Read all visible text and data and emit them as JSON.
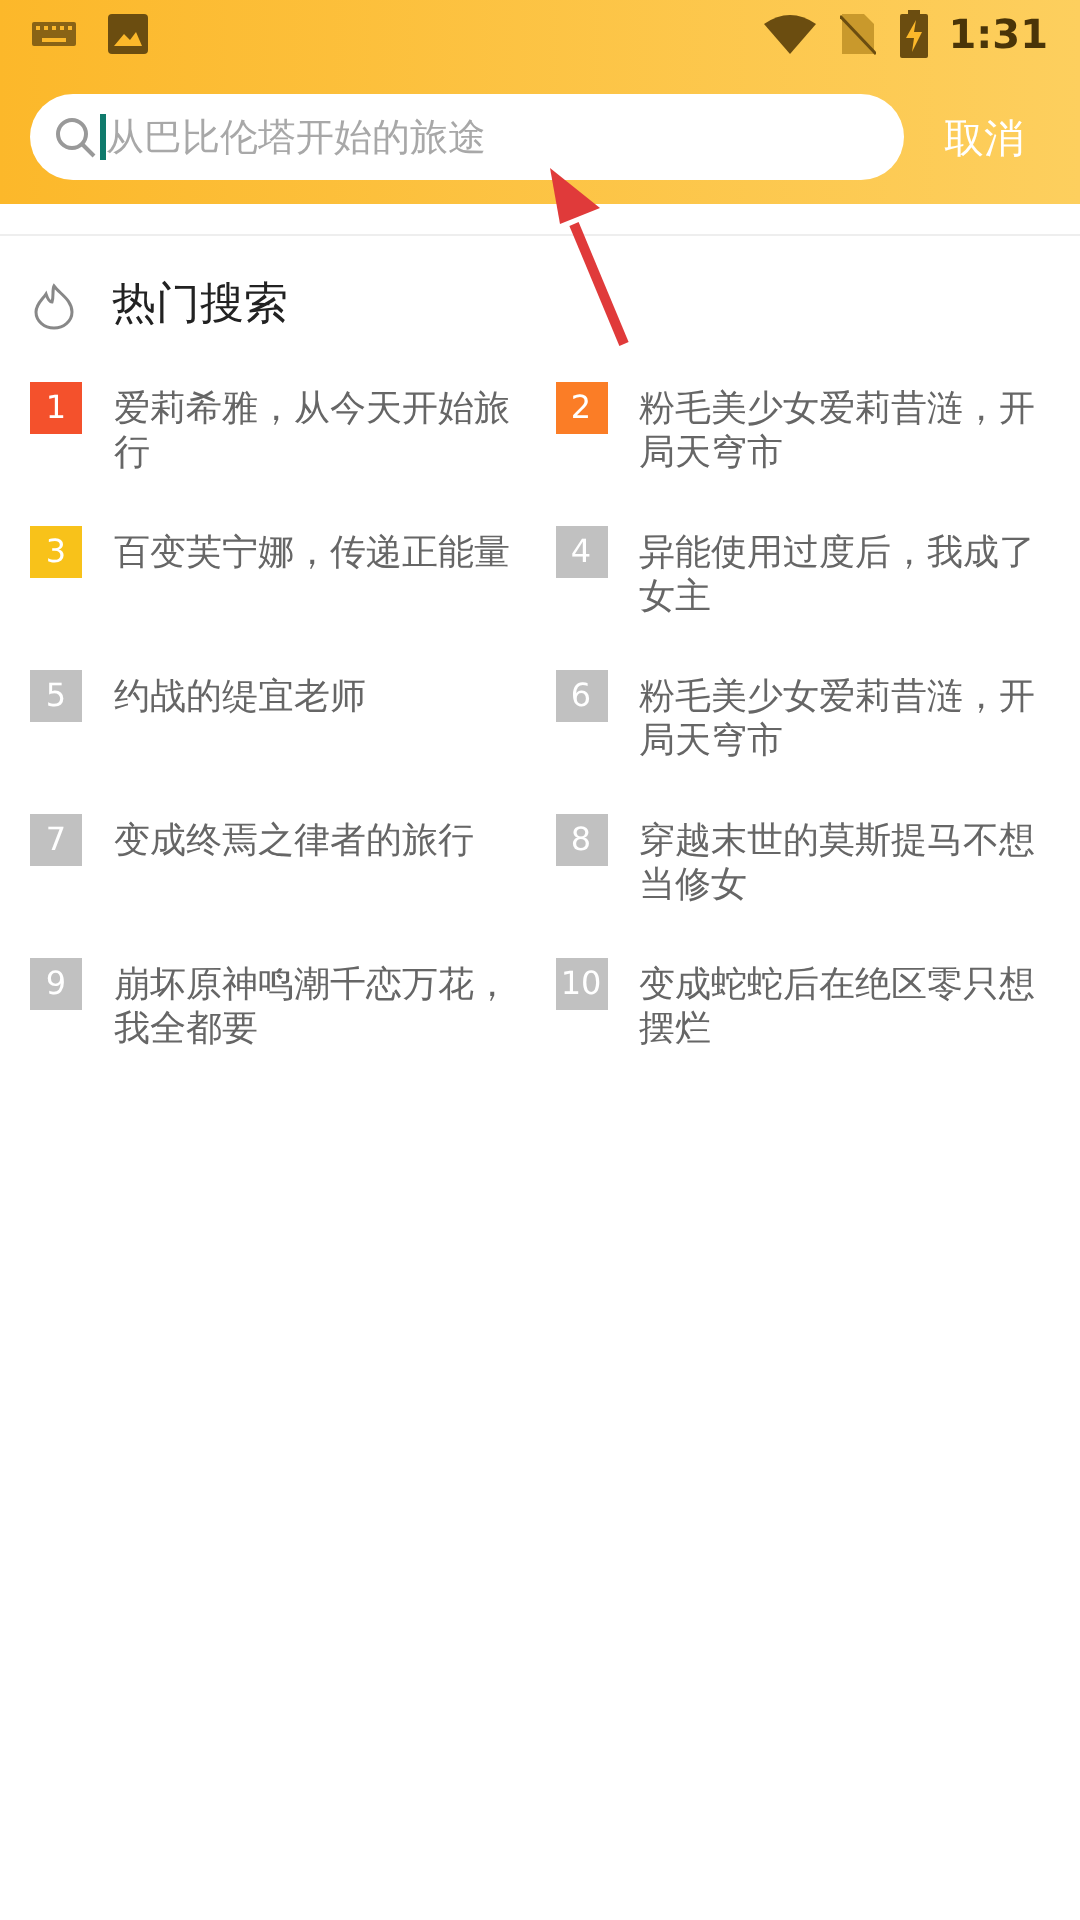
{
  "status_bar": {
    "time": "1:31"
  },
  "search": {
    "placeholder": "从巴比伦塔开始的旅途"
  },
  "cancel": "取消",
  "hot_search": {
    "title": "热门搜索",
    "items": [
      {
        "rank": "1",
        "title": "爱莉希雅，从今天开始旅行",
        "color": "#f4512c"
      },
      {
        "rank": "2",
        "title": "粉毛美少女爱莉昔涟，开局天穹市",
        "color": "#fb7d26"
      },
      {
        "rank": "3",
        "title": "百变芙宁娜，传递正能量",
        "color": "#f8c21a"
      },
      {
        "rank": "4",
        "title": "异能使用过度后，我成了女主",
        "color": "#c1c1c1"
      },
      {
        "rank": "5",
        "title": "约战的缇宜老师",
        "color": "#c1c1c1"
      },
      {
        "rank": "6",
        "title": "粉毛美少女爱莉昔涟，开局天穹市",
        "color": "#c1c1c1"
      },
      {
        "rank": "7",
        "title": "变成终焉之律者的旅行",
        "color": "#c1c1c1"
      },
      {
        "rank": "8",
        "title": "穿越末世的莫斯提马不想当修女",
        "color": "#c1c1c1"
      },
      {
        "rank": "9",
        "title": "崩坏原神鸣潮千恋万花，我全都要",
        "color": "#c1c1c1"
      },
      {
        "rank": "10",
        "title": "变成蛇蛇后在绝区零只想摆烂",
        "color": "#c1c1c1"
      }
    ]
  }
}
